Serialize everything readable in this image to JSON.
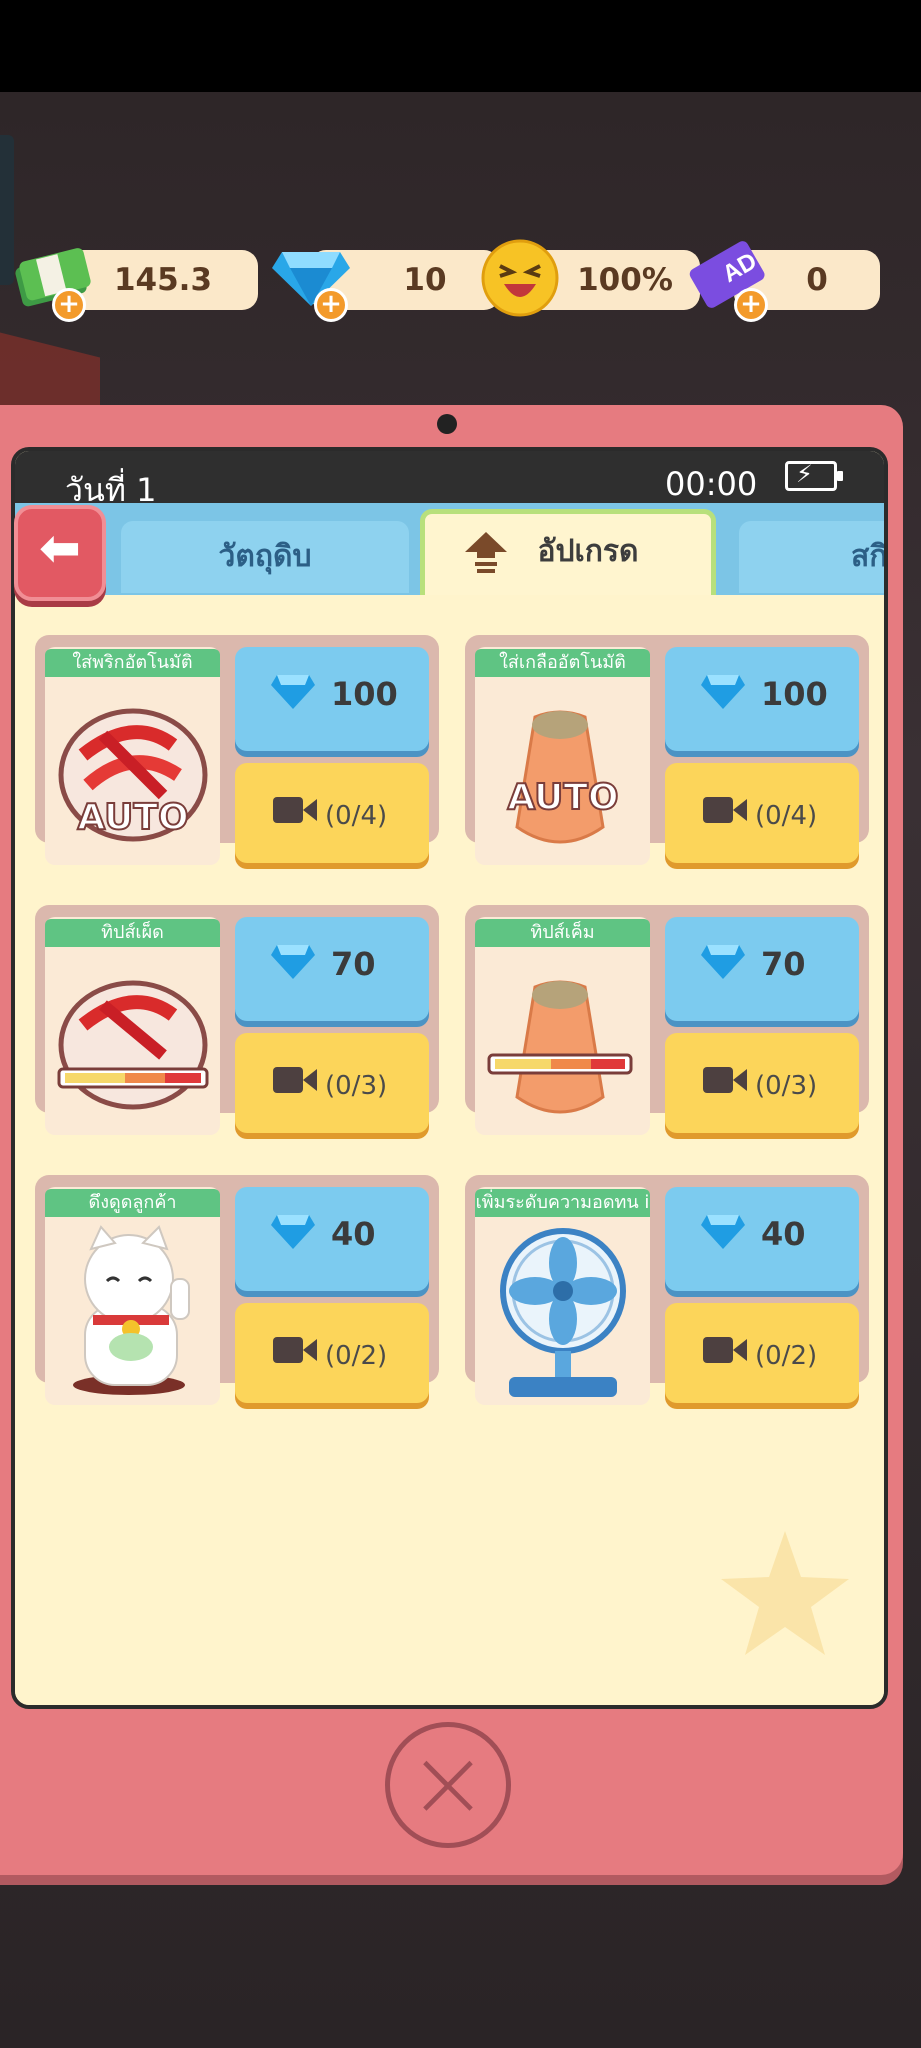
{
  "resources": {
    "money": "145.3",
    "gems": "10",
    "happiness": "100%",
    "ad_tickets": "0",
    "ad_icon_text": "AD"
  },
  "phone": {
    "day": "วันที่ 1",
    "time": "00:00"
  },
  "tabs": [
    {
      "label": "วัตถุดิบ"
    },
    {
      "label": "อัปเกรด",
      "active": true
    },
    {
      "label": "สกิ"
    }
  ],
  "upgrades": [
    {
      "name": "ใส่พริกอัตโนมัติ",
      "icon": "chili-plate-auto-icon",
      "badge": "AUTO",
      "gem_cost": "100",
      "ad_progress": "(0/4)"
    },
    {
      "name": "ใส่เกลืออัตโนมัติ",
      "icon": "salt-shaker-auto-icon",
      "badge": "AUTO",
      "gem_cost": "100",
      "ad_progress": "(0/4)"
    },
    {
      "name": "ทิปส์เผ็ด",
      "icon": "chili-plate-meter-icon",
      "gem_cost": "70",
      "ad_progress": "(0/3)"
    },
    {
      "name": "ทิปส์เค็ม",
      "icon": "salt-shaker-meter-icon",
      "gem_cost": "70",
      "ad_progress": "(0/3)"
    },
    {
      "name": "ดึงดูดลูกค้า",
      "icon": "lucky-cat-icon",
      "gem_cost": "40",
      "ad_progress": "(0/2)"
    },
    {
      "name": "เพิ่มระดับความอดทน i",
      "icon": "electric-fan-icon",
      "gem_cost": "40",
      "ad_progress": "(0/2)"
    }
  ],
  "colors": {
    "tablet": "#e67b80",
    "screen": "#fff4cc",
    "gem_button": "#7ccbef",
    "ad_button": "#fcd55a",
    "label": "#5fc483",
    "back_button": "#e25963"
  }
}
